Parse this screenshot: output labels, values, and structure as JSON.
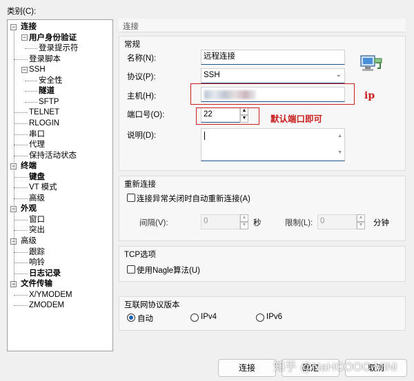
{
  "category_label": "类别(C):",
  "tree": [
    {
      "label": "连接",
      "bold": true,
      "level": 0
    },
    {
      "label": "用户身份验证",
      "bold": true,
      "level": 1
    },
    {
      "label": "登录提示符",
      "bold": false,
      "level": 2
    },
    {
      "label": "登录脚本",
      "bold": false,
      "level": 1
    },
    {
      "label": "SSH",
      "bold": false,
      "level": 1
    },
    {
      "label": "安全性",
      "bold": false,
      "level": 2
    },
    {
      "label": "隧道",
      "bold": true,
      "level": 2
    },
    {
      "label": "SFTP",
      "bold": false,
      "level": 2
    },
    {
      "label": "TELNET",
      "bold": false,
      "level": 1
    },
    {
      "label": "RLOGIN",
      "bold": false,
      "level": 1
    },
    {
      "label": "串口",
      "bold": false,
      "level": 1
    },
    {
      "label": "代理",
      "bold": false,
      "level": 1
    },
    {
      "label": "保持活动状态",
      "bold": false,
      "level": 1
    },
    {
      "label": "终端",
      "bold": true,
      "level": 0
    },
    {
      "label": "键盘",
      "bold": true,
      "level": 1
    },
    {
      "label": "VT 模式",
      "bold": false,
      "level": 1
    },
    {
      "label": "高级",
      "bold": false,
      "level": 1
    },
    {
      "label": "外观",
      "bold": true,
      "level": 0
    },
    {
      "label": "窗口",
      "bold": false,
      "level": 1
    },
    {
      "label": "突出",
      "bold": false,
      "level": 1
    },
    {
      "label": "高级",
      "bold": false,
      "level": 0
    },
    {
      "label": "跟踪",
      "bold": false,
      "level": 1
    },
    {
      "label": "响铃",
      "bold": false,
      "level": 1
    },
    {
      "label": "日志记录",
      "bold": true,
      "level": 1
    },
    {
      "label": "文件传输",
      "bold": true,
      "level": 0
    },
    {
      "label": "X/YMODEM",
      "bold": false,
      "level": 1
    },
    {
      "label": "ZMODEM",
      "bold": false,
      "level": 1
    }
  ],
  "section_header": "连接",
  "general": {
    "title": "常规",
    "name_label": "名称(N):",
    "name_value": "远程连接",
    "protocol_label": "协议(P):",
    "protocol_value": "SSH",
    "host_label": "主机(H):",
    "port_label": "端口号(O):",
    "port_value": "22",
    "desc_label": "说明(D):"
  },
  "annotations": {
    "ip": "ip",
    "port_note": "默认端口即可"
  },
  "reconnect": {
    "title": "重新连接",
    "checkbox_label": "连接异常关闭时自动重新连接(A)",
    "interval_label": "间隔(V):",
    "interval_value": "0",
    "interval_unit": "秒",
    "limit_label": "限制(L):",
    "limit_value": "0",
    "limit_unit": "分钟"
  },
  "tcp": {
    "title": "TCP选项",
    "nagle_label": "使用Nagle算法(U)"
  },
  "ipver": {
    "title": "互联网协议版本",
    "options": [
      "自动",
      "IPv4",
      "IPv6"
    ]
  },
  "buttons": {
    "connect": "连接",
    "ok": "确定",
    "cancel": "取消"
  },
  "watermark": "知乎 @NaHCOOC MiNi"
}
